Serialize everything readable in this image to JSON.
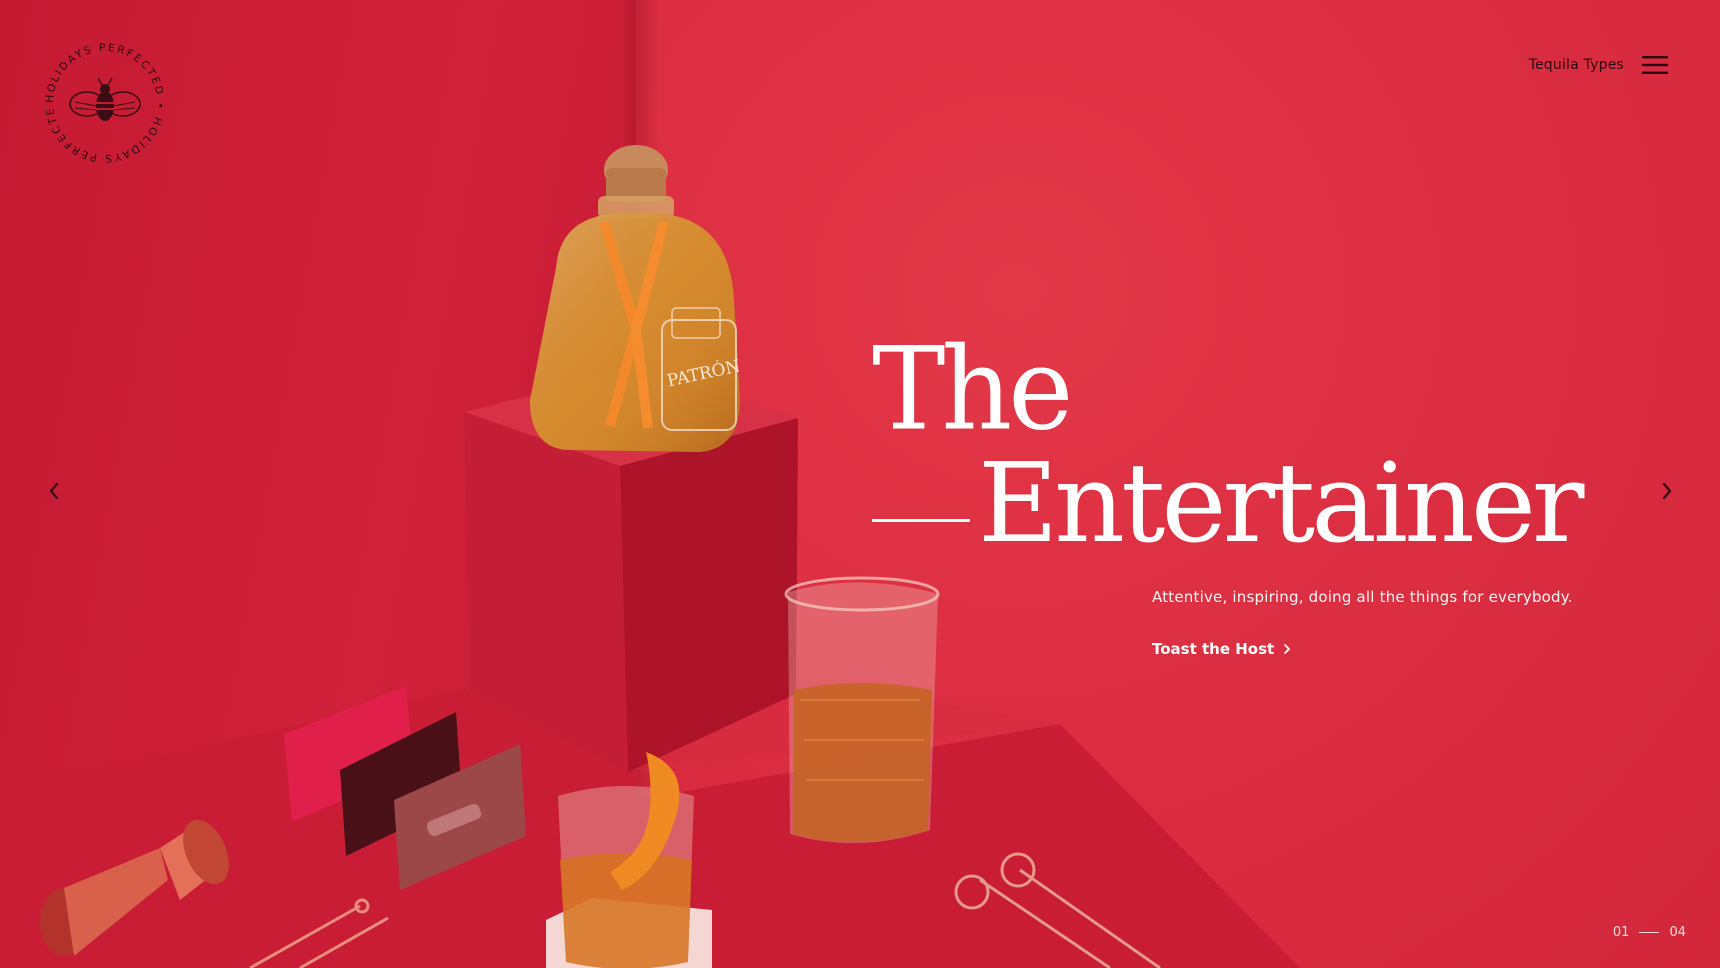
{
  "brand": {
    "logo_ring_text": "HOLIDAYS PERFECTED • HOLIDAYS PERFECTED •"
  },
  "nav": {
    "link_label": "Tequila Types"
  },
  "hero": {
    "title_line1": "The",
    "title_line2": "Entertainer",
    "subtitle": "Attentive, inspiring, doing all the things for everybody.",
    "cta_label": "Toast the Host"
  },
  "pager": {
    "current": "01",
    "total": "04"
  },
  "icons": {
    "menu": "hamburger-menu-icon",
    "prev": "chevron-left-icon",
    "next": "chevron-right-icon",
    "cta": "chevron-right-icon",
    "logo": "bee-icon"
  },
  "colors": {
    "background": "#d6243a",
    "text_dark": "#2a0a10",
    "text_light": "#ffffff"
  }
}
